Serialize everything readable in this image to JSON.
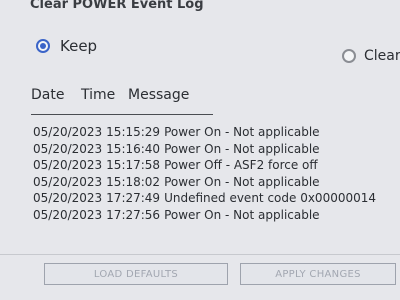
{
  "title": "Clear POWER Event Log",
  "options": {
    "keep_label": "Keep",
    "clear_label": "Clear"
  },
  "columns": {
    "date": "Date",
    "time": "Time",
    "message": "Message"
  },
  "log": [
    {
      "date": "05/20/2023",
      "time": "15:15:29",
      "message": "Power On  - Not applicable"
    },
    {
      "date": "05/20/2023",
      "time": "15:16:40",
      "message": "Power On  - Not applicable"
    },
    {
      "date": "05/20/2023",
      "time": "15:17:58",
      "message": "Power Off - ASF2 force off"
    },
    {
      "date": "05/20/2023",
      "time": "15:18:02",
      "message": "Power On  - Not applicable"
    },
    {
      "date": "05/20/2023",
      "time": "17:27:49",
      "message": "Undefined event code 0x00000014"
    },
    {
      "date": "05/20/2023",
      "time": "17:27:56",
      "message": "Power On  - Not applicable"
    }
  ],
  "buttons": {
    "load_defaults": "LOAD DEFAULTS",
    "apply_changes": "APPLY CHANGES"
  },
  "colors": {
    "accent": "#3b64c8",
    "background": "#e6e7eb"
  }
}
